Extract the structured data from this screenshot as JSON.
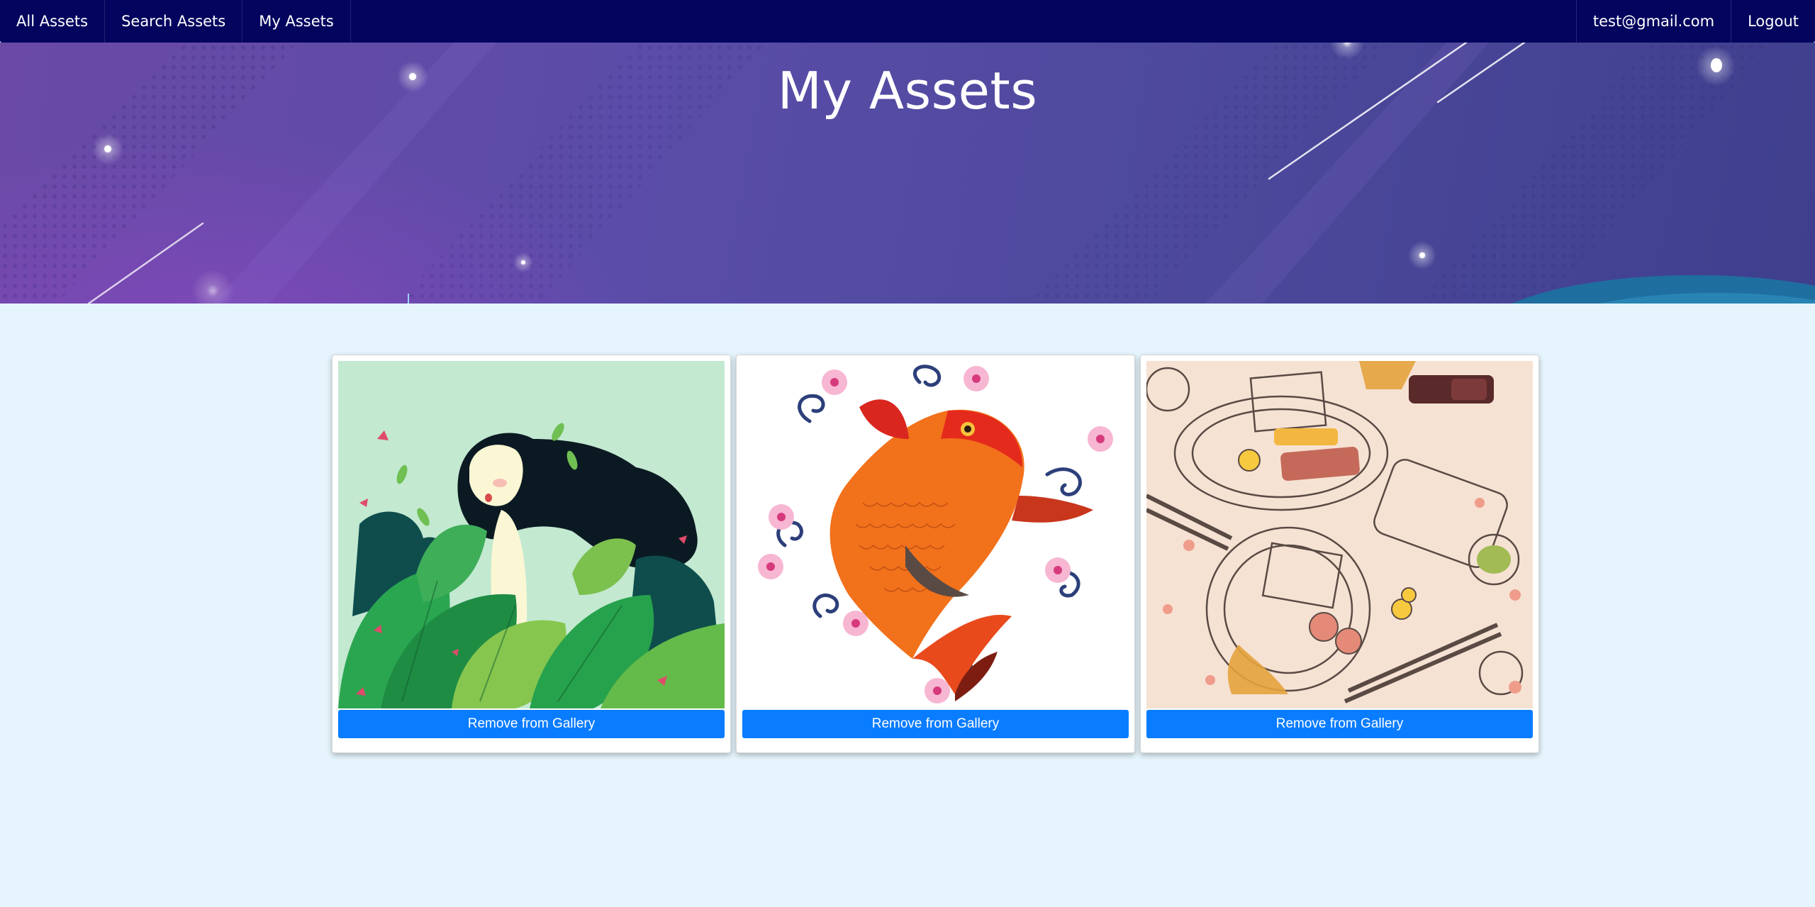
{
  "nav": {
    "left": [
      {
        "label": "All Assets"
      },
      {
        "label": "Search Assets"
      },
      {
        "label": "My Assets"
      }
    ],
    "right": [
      {
        "label": "test@gmail.com"
      },
      {
        "label": "Logout"
      }
    ]
  },
  "hero": {
    "title": "My Assets"
  },
  "cards": [
    {
      "image": "girl-with-leaves-illustration",
      "button_label": "Remove from Gallery"
    },
    {
      "image": "koi-fish-with-cherry-blossoms",
      "button_label": "Remove from Gallery"
    },
    {
      "image": "asian-food-doodle-pattern",
      "button_label": "Remove from Gallery"
    }
  ],
  "colors": {
    "navbar": "#03045e",
    "page_background": "#e6f5fd",
    "button": "#0a7cff",
    "hero_purple": "#5a4ca8"
  }
}
